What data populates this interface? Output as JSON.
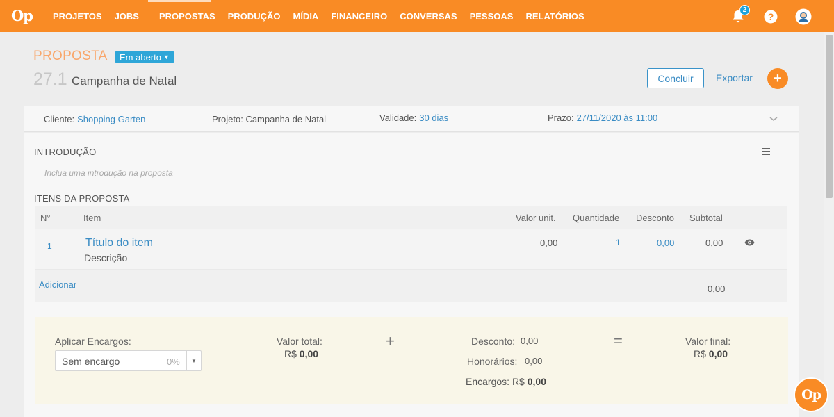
{
  "app": {
    "logo": "Op",
    "fab_label": "Op"
  },
  "nav": {
    "items": [
      "PROJETOS",
      "JOBS",
      "PROPOSTAS",
      "PRODUÇÃO",
      "MÍDIA",
      "FINANCEIRO",
      "CONVERSAS",
      "PESSOAS",
      "RELATÓRIOS"
    ],
    "notification_count": "2",
    "help_glyph": "?",
    "icons": [
      "bell-icon",
      "help-icon",
      "user-avatar-icon"
    ]
  },
  "header": {
    "label": "PROPOSTA",
    "status": "Em aberto",
    "number": "27.1",
    "title": "Campanha de Natal",
    "concluir_label": "Concluir",
    "exportar_label": "Exportar",
    "add_label": "+"
  },
  "info": {
    "cliente_label": "Cliente:",
    "cliente_value": "Shopping Garten",
    "projeto_label": "Projeto:",
    "projeto_value": "Campanha de Natal",
    "validade_label": "Validade:",
    "validade_value": "30 dias",
    "prazo_label": "Prazo:",
    "prazo_value": "27/11/2020 às 11:00"
  },
  "intro": {
    "title": "INTRODUÇÃO",
    "placeholder": "Inclua uma introdução na proposta"
  },
  "items": {
    "title": "ITENS DA PROPOSTA",
    "columns": {
      "num": "N°",
      "item": "Item",
      "unit": "Valor unit.",
      "qty": "Quantidade",
      "discount": "Desconto",
      "subtotal": "Subtotal"
    },
    "rows": [
      {
        "num": "1",
        "title": "Título do item",
        "description": "Descrição",
        "unit": "0,00",
        "qty": "1",
        "discount": "0,00",
        "subtotal": "0,00"
      }
    ],
    "add_label": "Adicionar",
    "total": "0,00"
  },
  "summary": {
    "encargos_label": "Aplicar Encargos:",
    "encargos_select": "Sem encargo",
    "encargos_pct": "0%",
    "valor_total_label": "Valor total:",
    "currency": "R$",
    "valor_total_value": "0,00",
    "plus": "+",
    "desconto_label": "Desconto:",
    "desconto_value": "0,00",
    "honorarios_label": "Honorários:",
    "honorarios_value": "0,00",
    "encargos_total_label": "Encargos:",
    "encargos_total_value": "0,00",
    "equals": "=",
    "valor_final_label": "Valor final:",
    "valor_final_value": "0,00"
  },
  "colors": {
    "brand_orange": "#f98b25",
    "link_blue": "#3a8cc4",
    "badge_blue": "#2ea6d8"
  }
}
